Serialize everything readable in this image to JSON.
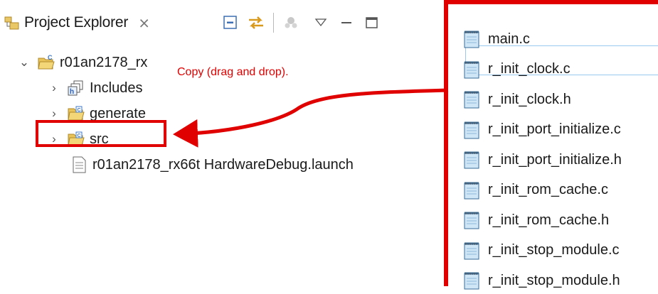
{
  "view": {
    "title": "Project Explorer",
    "close_glyph": "⨯"
  },
  "toolbar": {
    "buttons": [
      "collapse-all-icon",
      "link-with-editor-icon",
      "focus-icon",
      "view-menu-icon",
      "minimize-icon",
      "maximize-icon"
    ]
  },
  "tree": {
    "project": {
      "label": "r01an2178_rx"
    },
    "includes": {
      "label": "Includes"
    },
    "generate": {
      "label": "generate"
    },
    "src": {
      "label": "src"
    },
    "launch": {
      "label": "r01an2178_rx66t HardwareDebug.launch"
    }
  },
  "annotation": {
    "text": "Copy (drag and drop)."
  },
  "files": [
    "main.c",
    "r_init_clock.c",
    "r_init_clock.h",
    "r_init_port_initialize.c",
    "r_init_port_initialize.h",
    "r_init_rom_cache.c",
    "r_init_rom_cache.h",
    "r_init_stop_module.c",
    "r_init_stop_module.h"
  ],
  "colors": {
    "highlight": "#e00000",
    "selection_border": "#99c9ef",
    "folder": "#e0b64a",
    "project_blue": "#3c78c8"
  }
}
